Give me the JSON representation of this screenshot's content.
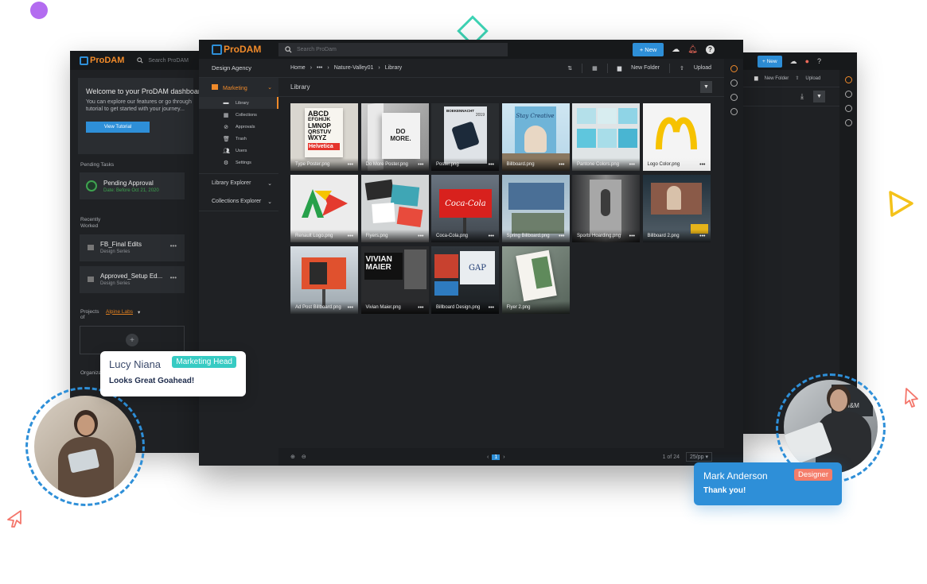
{
  "brand": {
    "logo": "ProDAM",
    "accent": "#f08a2a",
    "primary": "#2e8fd8"
  },
  "topbar": {
    "search_placeholder": "Search ProDam",
    "new_button": "+ New"
  },
  "sidebar": {
    "org": "Design Agency",
    "section_marketing": "Marketing",
    "items": [
      {
        "label": "Library",
        "icon": "folder-icon"
      },
      {
        "label": "Collections",
        "icon": "grid-icon"
      },
      {
        "label": "Approvals",
        "icon": "check-circle-icon"
      },
      {
        "label": "Trash",
        "icon": "trash-icon"
      },
      {
        "label": "Users",
        "icon": "users-icon"
      },
      {
        "label": "Settings",
        "icon": "gear-icon"
      }
    ],
    "library_explorer": "Library Explorer",
    "collections_explorer": "Collections Explorer"
  },
  "breadcrumb": {
    "home": "Home",
    "ellipsis": "•••",
    "folder": "Nature-Valley01",
    "current": "Library"
  },
  "toolbar": {
    "new_folder": "New Folder",
    "upload": "Upload"
  },
  "library": {
    "title": "Library",
    "files": [
      "Type Poster.png",
      "Do More Poster.png",
      "Poster.png",
      "Billboard.png",
      "Pantone Colors.png",
      "Logo Color.png",
      "Renault Logo.png",
      "Flyers.png",
      "Coca-Cola.png",
      "Spring Billboard.png",
      "Sports Hoarding.png",
      "Billboard 2.png",
      "Ad Post Billboard.png",
      "Vivian Maier.png",
      "Billboard Design.png",
      "Flyer 2.png"
    ],
    "thumbnail_text": {
      "type_poster": [
        "ABCD",
        "EFGHIJK",
        "LMNOP",
        "QRSTUV",
        "WXYZ",
        "Helvetica"
      ],
      "do_more": "DO MORE.",
      "poster_top": "BOEKENNACHT",
      "poster_year": "2019",
      "billboard_script": "Stay Creative",
      "vivian": "VIVIAN MAIER",
      "gap": "GAP",
      "coca_cola": "Coca-Cola"
    }
  },
  "footer": {
    "page_current": "1",
    "page_info": "1 of 24",
    "per_page": "25/pp"
  },
  "back_left": {
    "search": "Search ProDAM",
    "welcome_title": "Welcome to your ProDAM dashboard",
    "welcome_line1": "You can explore our features or go through",
    "welcome_line2": "tutorial to get started with your journey...",
    "tutorial_button": "View Tutorial",
    "pending_tasks": "Pending Tasks",
    "pending_title": "Pending Approval",
    "pending_date": "Date: Before Oct 21, 2020",
    "recently_worked": "Recently Worked",
    "files": [
      {
        "name": "FB_Final Edits",
        "sub": "Design Series"
      },
      {
        "name": "Approved_Setup Ed...",
        "sub": "Design Series"
      }
    ],
    "projects_of": "Projects of",
    "project_selected": "Alpine Labs",
    "organization": "Organizations",
    "add": "+"
  },
  "back_right": {
    "new_button": "+ New",
    "new_folder": "New Folder",
    "upload": "Upload"
  },
  "chat_left": {
    "name": "Lucy Niana",
    "role": "Marketing Head",
    "message": "Looks Great Goahead!"
  },
  "chat_right": {
    "name": "Mark Anderson",
    "role": "Designer",
    "message": "Thank you!"
  },
  "avatar_right_badge": "MI&M"
}
